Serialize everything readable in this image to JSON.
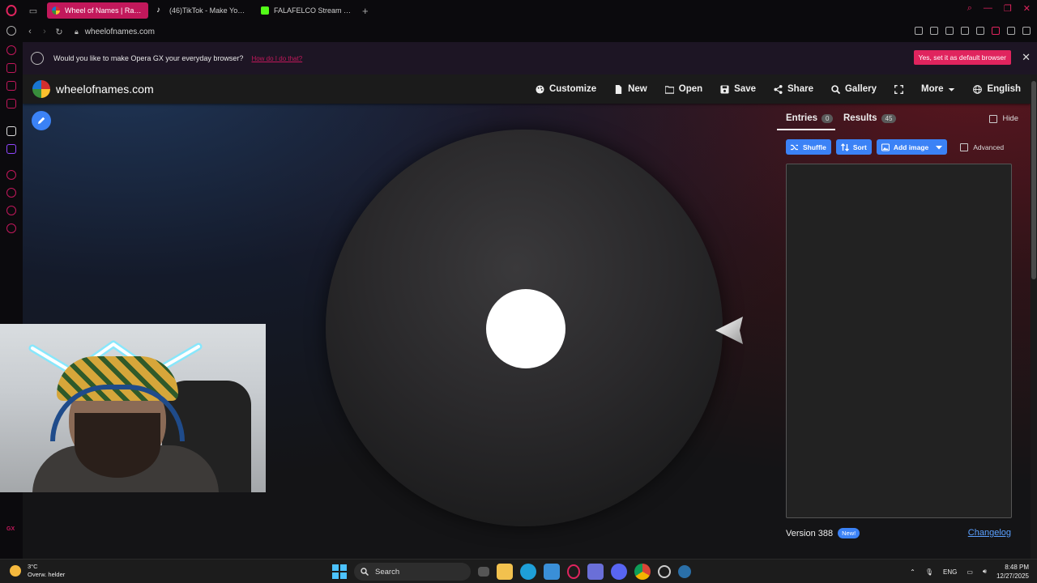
{
  "browser": {
    "tabs": [
      {
        "title": "Wheel of Names | Random",
        "active": true,
        "favicon_color": "#e53935"
      },
      {
        "title": "(46)TikTok - Make Your D",
        "active": false,
        "favicon_color": "#ffffff"
      },
      {
        "title": "FALAFELCO Stream - Wat",
        "active": false,
        "favicon_color": "#53fc18"
      }
    ],
    "url": "wheelofnames.com",
    "notice": {
      "text": "Would you like to make Opera GX your everyday browser?",
      "link": "How do I do that?",
      "button": "Yes, set it as default browser"
    },
    "accent_color": "#e0245e"
  },
  "site": {
    "name": "wheelofnames.com",
    "menu": [
      {
        "label": "Customize",
        "icon": "palette-icon"
      },
      {
        "label": "New",
        "icon": "file-icon"
      },
      {
        "label": "Open",
        "icon": "folder-icon"
      },
      {
        "label": "Save",
        "icon": "save-icon"
      },
      {
        "label": "Share",
        "icon": "share-icon"
      },
      {
        "label": "Gallery",
        "icon": "search-icon"
      },
      {
        "label": "",
        "icon": "fullscreen-icon"
      },
      {
        "label": "More",
        "icon": "chevron-down-icon"
      },
      {
        "label": "English",
        "icon": "globe-icon"
      }
    ],
    "panel": {
      "entries_label": "Entries",
      "entries_count": "0",
      "results_label": "Results",
      "results_count": "45",
      "hide_label": "Hide",
      "buttons": {
        "shuffle": "Shuffle",
        "sort": "Sort",
        "add_image": "Add image"
      },
      "advanced_label": "Advanced",
      "entries_text": "",
      "version": "Version 388",
      "new_badge": "New!",
      "changelog": "Changelog"
    },
    "button_color": "#3b82f6"
  },
  "taskbar": {
    "temperature": "3°C",
    "weather": "Overw. helder",
    "search_placeholder": "Search",
    "language": "ENG",
    "time": "8:48 PM",
    "date": "12/27/2025"
  }
}
